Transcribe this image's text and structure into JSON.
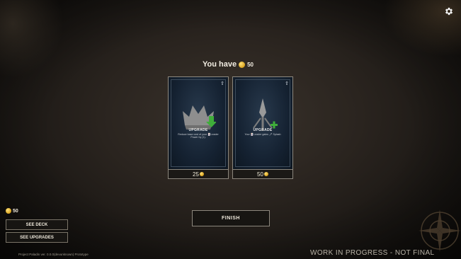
{
  "header": {
    "you_have_label": "You have",
    "coins": "50"
  },
  "cards": [
    {
      "title": "UPGRADE",
      "description": "Reduce base cost of your 🃏Leader Power by (1).",
      "price": "25",
      "art_icon": "crown-icon",
      "modifier_icon": "green-down-arrow-icon"
    },
    {
      "title": "UPGRADE",
      "description": "Your 🃏Leader gains 🗡 Splash",
      "price": "50",
      "art_icon": "spear-icon",
      "modifier_icon": "green-plus-icon"
    }
  ],
  "finish_label": "FINISH",
  "wallet": {
    "coins": "50"
  },
  "see_deck_label": "SEE DECK",
  "see_upgrades_label": "SEE UPGRADES",
  "version_text": "Project Paladin ver. 0.0.0(devunknown) Prototype",
  "watermark": "WORK IN PROGRESS - NOT FINAL",
  "colors": {
    "accent_gold": "#d9a21c",
    "card_blue": "#152232",
    "upgrade_green": "#3fae3a"
  }
}
